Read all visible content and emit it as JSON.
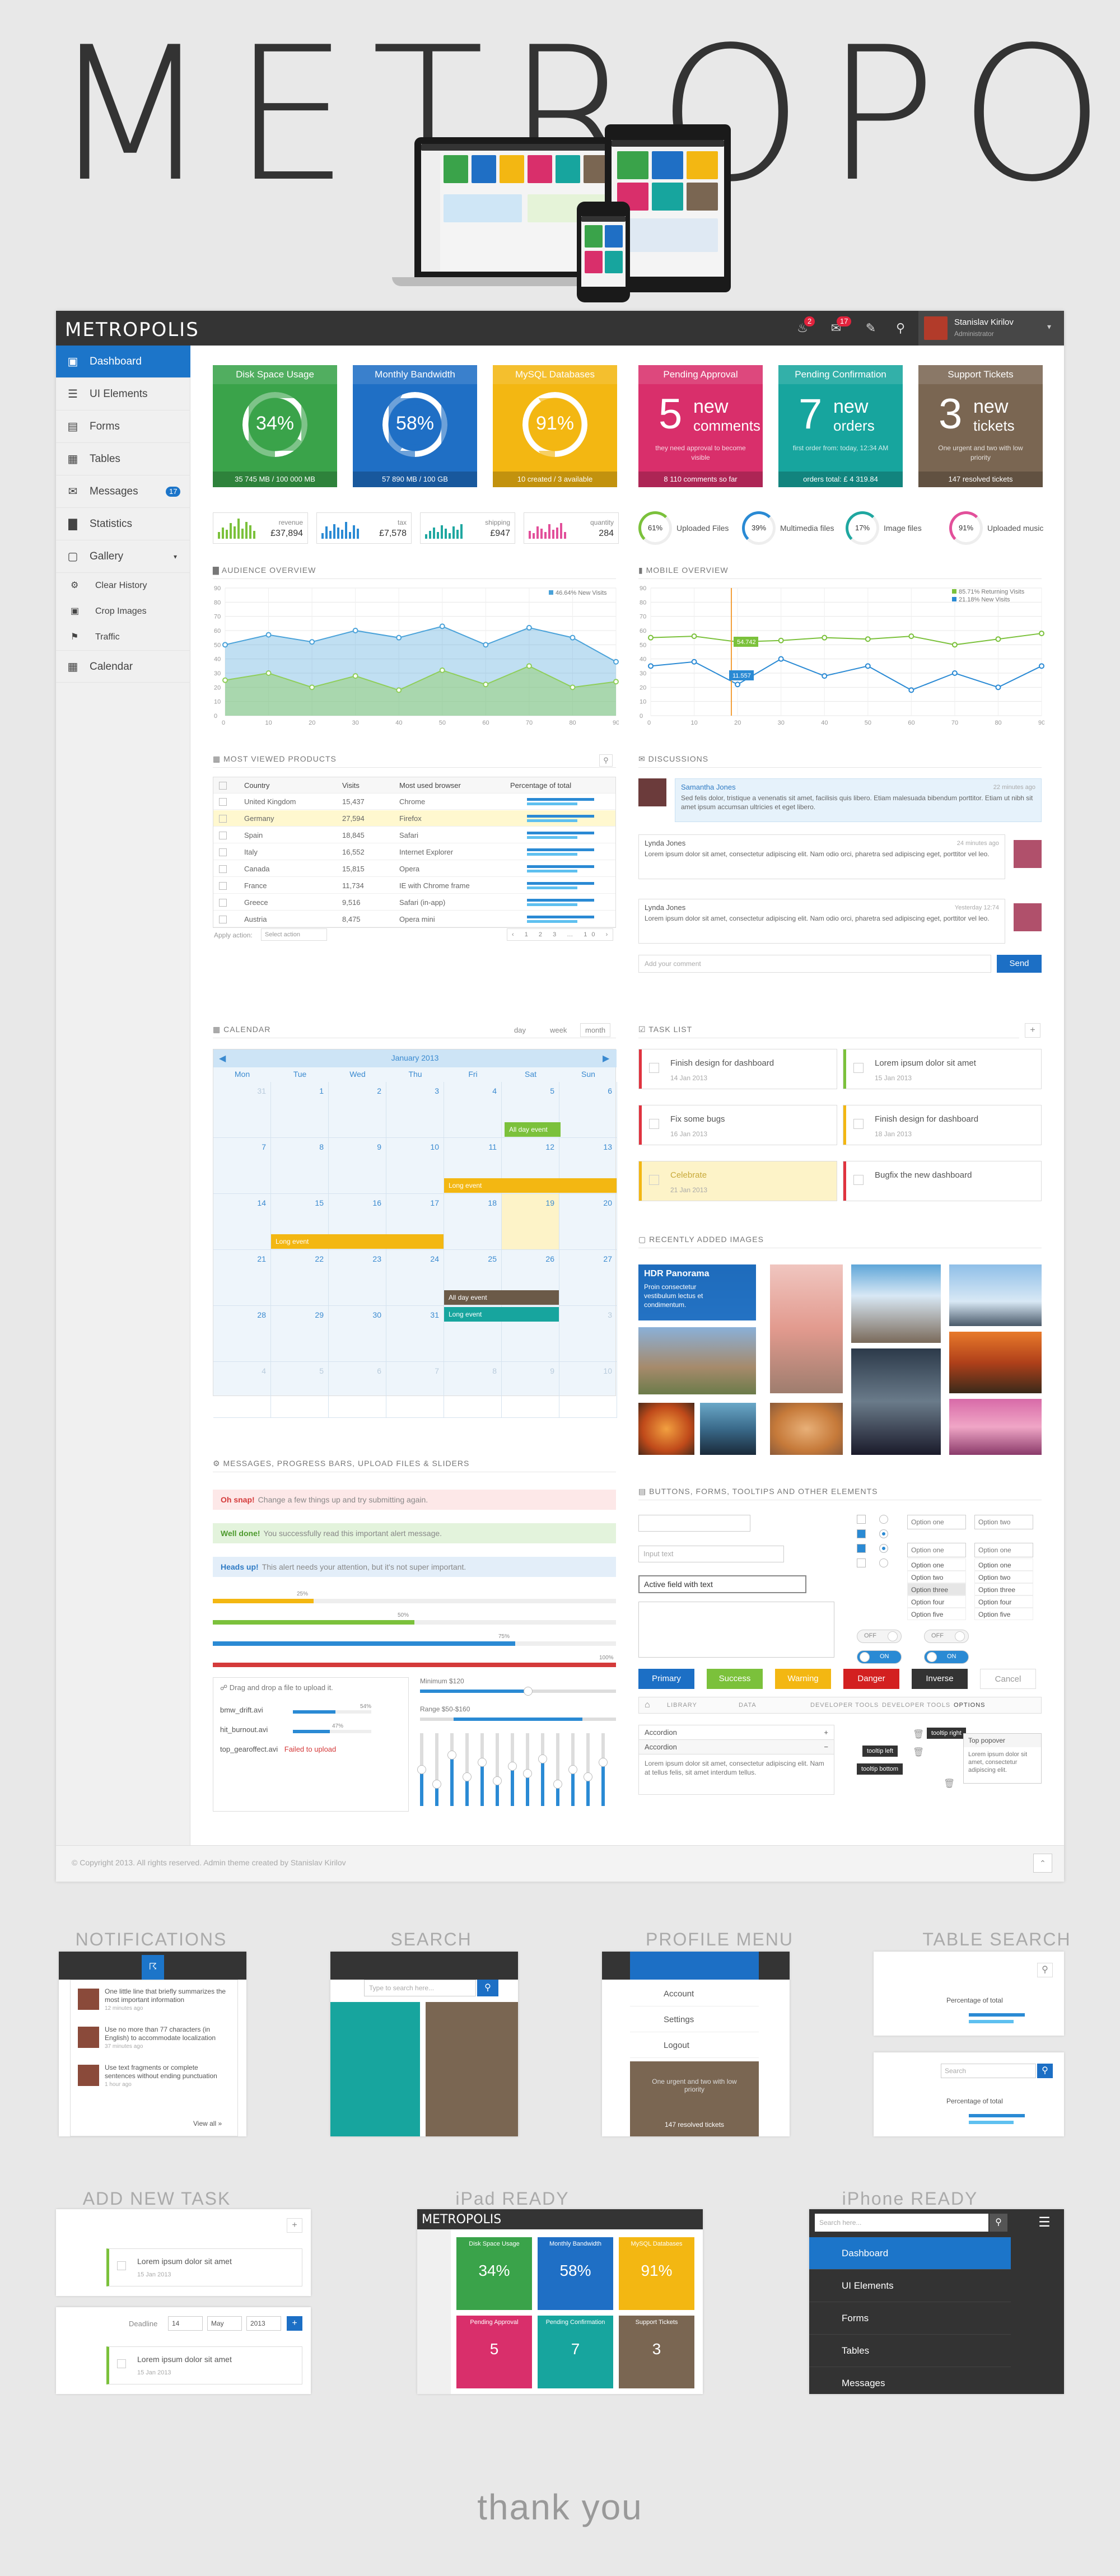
{
  "hero": {
    "title": "METROPOLIS"
  },
  "app": {
    "logo": "METROPOLIS",
    "notif_badge": "2",
    "mail_badge": "17",
    "user_name": "Stanislav Kirilov",
    "user_role": "Administrator"
  },
  "sidebar": {
    "items": [
      {
        "label": "Dashboard",
        "icon": "monitor-icon"
      },
      {
        "label": "UI Elements",
        "icon": "sliders-icon"
      },
      {
        "label": "Forms",
        "icon": "form-icon"
      },
      {
        "label": "Tables",
        "icon": "table-icon"
      },
      {
        "label": "Messages",
        "icon": "chat-icon",
        "badge": "17"
      },
      {
        "label": "Statistics",
        "icon": "chart-icon"
      },
      {
        "label": "Gallery",
        "icon": "image-icon"
      }
    ],
    "sub_items": [
      {
        "label": "Clear History"
      },
      {
        "label": "Crop Images"
      },
      {
        "label": "Traffic"
      }
    ],
    "calendar": {
      "label": "Calendar"
    }
  },
  "tiles": [
    {
      "title": "Disk Space Usage",
      "value": "34%",
      "footer": "35 745 MB / 100 000 MB",
      "color": "#3aa34a",
      "fill": 0.34
    },
    {
      "title": "Monthly Bandwidth",
      "value": "58%",
      "footer": "57 890 MB / 100 GB",
      "color": "#1f6fc5",
      "fill": 0.58
    },
    {
      "title": "MySQL Databases",
      "value": "91%",
      "footer": "10 created / 3 available",
      "color": "#f3b712",
      "fill": 0.91
    },
    {
      "title": "Pending Approval",
      "num": "5",
      "w1": "new",
      "w2": "comments",
      "desc": "they need approval to become visible",
      "footer": "8 110 comments so far",
      "color": "#d92f6b"
    },
    {
      "title": "Pending Confirmation",
      "num": "7",
      "w1": "new",
      "w2": "orders",
      "desc": "first order from: today, 12:34 AM",
      "footer": "orders total: £ 4 319.84",
      "color": "#17a59e"
    },
    {
      "title": "Support Tickets",
      "num": "3",
      "w1": "new",
      "w2": "tickets",
      "desc": "One urgent and two with low priority",
      "footer": "147 resolved tickets",
      "color": "#7a6652"
    }
  ],
  "stat_boxes": [
    {
      "label": "revenue",
      "value": "£37,894",
      "color": "#7bc13b"
    },
    {
      "label": "tax",
      "value": "£7,578",
      "color": "#2a8ad4"
    },
    {
      "label": "shipping",
      "value": "£947",
      "color": "#1fa7a0"
    },
    {
      "label": "quantity",
      "value": "284",
      "color": "#e24f9a"
    }
  ],
  "donuts": [
    {
      "value": "61%",
      "label": "Uploaded Files",
      "color": "#7bc13b"
    },
    {
      "value": "39%",
      "label": "Multimedia files",
      "color": "#2a8ad4"
    },
    {
      "value": "17%",
      "label": "Image files",
      "color": "#1fa7a0"
    },
    {
      "value": "91%",
      "label": "Uploaded music",
      "color": "#e24f9a"
    }
  ],
  "sections": {
    "audience": "AUDIENCE OVERVIEW",
    "mobile": "MOBILE OVERVIEW",
    "products": "MOST VIEWED PRODUCTS",
    "discussions": "DISCUSSIONS",
    "calendar": "CALENDAR",
    "tasks": "TASK LIST",
    "images": "RECENTLY ADDED IMAGES",
    "messages": "MESSAGES, PROGRESS BARS, UPLOAD FILES & SLIDERS",
    "buttons": "BUTTONS, FORMS, TOOLTIPS AND OTHER ELEMENTS"
  },
  "chart_data": [
    {
      "type": "area",
      "title": "",
      "legend": "46.64% New Visits",
      "x": [
        0,
        10,
        20,
        30,
        40,
        50,
        60,
        70,
        80,
        90
      ],
      "ylim": [
        0,
        90
      ],
      "y_ticks": [
        90,
        80,
        70,
        60,
        50,
        40,
        30,
        20,
        10,
        0
      ],
      "series": [
        {
          "values": [
            50,
            57,
            52,
            60,
            55,
            63,
            50,
            62,
            55,
            38
          ],
          "color": "#4aa2d9"
        },
        {
          "values": [
            25,
            30,
            20,
            28,
            18,
            32,
            22,
            35,
            20,
            24
          ],
          "color": "#8fce5a"
        }
      ]
    },
    {
      "type": "line",
      "title": "",
      "legend": [
        "85.71% Returning Visits",
        "21.18% New Visits"
      ],
      "x": [
        0,
        10,
        20,
        30,
        40,
        50,
        60,
        70,
        80,
        90
      ],
      "ylim": [
        0,
        90
      ],
      "y_ticks": [
        90,
        80,
        70,
        60,
        50,
        40,
        30,
        20,
        10,
        0
      ],
      "callouts": [
        "54.742",
        "11.557"
      ],
      "series": [
        {
          "name": "85.71% Returning Visits",
          "values": [
            55,
            56,
            52,
            53,
            55,
            54,
            56,
            50,
            54,
            58
          ],
          "color": "#7bc13b"
        },
        {
          "name": "21.18% New Visits",
          "values": [
            35,
            38,
            22,
            40,
            28,
            35,
            18,
            30,
            20,
            35
          ],
          "color": "#2a8ad4"
        }
      ]
    }
  ],
  "products": {
    "headers": [
      "Country",
      "Visits",
      "Most used browser",
      "Percentage of total"
    ],
    "rows": [
      {
        "country": "United Kingdom",
        "visits": "15,437",
        "browser": "Chrome"
      },
      {
        "country": "Germany",
        "visits": "27,594",
        "browser": "Firefox"
      },
      {
        "country": "Spain",
        "visits": "18,845",
        "browser": "Safari"
      },
      {
        "country": "Italy",
        "visits": "16,552",
        "browser": "Internet Explorer"
      },
      {
        "country": "Canada",
        "visits": "15,815",
        "browser": "Opera"
      },
      {
        "country": "France",
        "visits": "11,734",
        "browser": "IE with Chrome frame"
      },
      {
        "country": "Greece",
        "visits": "9,516",
        "browser": "Safari (in-app)"
      },
      {
        "country": "Austria",
        "visits": "8,475",
        "browser": "Opera mini"
      }
    ],
    "apply_label": "Apply action:",
    "select_label": "Select action"
  },
  "discussions": {
    "items": [
      {
        "author": "Samantha Jones",
        "time": "22 minutes ago",
        "text": "Sed felis dolor, tristique a venenatis sit amet, facilisis quis libero. Etiam malesuada bibendum porttitor. Etiam ut nibh sit amet ipsum accumsan ultricies et eget libero."
      },
      {
        "author": "Lynda Jones",
        "time": "24 minutes ago",
        "text": "Lorem ipsum dolor sit amet, consectetur adipiscing elit. Nam odio orci, pharetra sed adipiscing eget, porttitor vel leo."
      },
      {
        "author": "Lynda Jones",
        "time": "Yesterday 12:74",
        "text": "Lorem ipsum dolor sit amet, consectetur adipiscing elit. Nam odio orci, pharetra sed adipiscing eget, porttitor vel leo."
      }
    ],
    "placeholder": "Add your comment",
    "send": "Send"
  },
  "calendar": {
    "views": [
      "day",
      "week",
      "month"
    ],
    "month": "January 2013",
    "weekdays": [
      "Mon",
      "Tue",
      "Wed",
      "Thu",
      "Fri",
      "Sat",
      "Sun"
    ],
    "events": [
      {
        "label": "All day event"
      },
      {
        "label": "Long event"
      },
      {
        "label": "Long event"
      },
      {
        "label": "All day event"
      },
      {
        "label": "Long event"
      }
    ]
  },
  "tasks": [
    {
      "title": "Finish design for dashboard",
      "date": "14 Jan 2013",
      "color": "#e0333f"
    },
    {
      "title": "Lorem ipsum dolor sit amet",
      "date": "15 Jan 2013",
      "color": "#7bc13b"
    },
    {
      "title": "Fix some bugs",
      "date": "16 Jan 2013",
      "color": "#e0333f"
    },
    {
      "title": "Finish design for dashboard",
      "date": "18 Jan 2013",
      "color": "#f3b712"
    },
    {
      "title": "Celebrate",
      "date": "21 Jan 2013",
      "color": "#f3b712"
    },
    {
      "title": "Bugfix the new dashboard",
      "date": "",
      "color": "#e0333f"
    }
  ],
  "images": {
    "feature_title": "HDR Panorama",
    "feature_text": "Proin consectetur vestibulum lectus et condimentum."
  },
  "alerts": [
    {
      "strong": "Oh snap!",
      "text": "Change a few things up and try submitting again.",
      "color": "#fde8e8",
      "fg": "#d43a3a"
    },
    {
      "strong": "Well done!",
      "text": "You successfully read this important alert message.",
      "color": "#e3f3dc",
      "fg": "#4d9a2d"
    },
    {
      "strong": "Heads up!",
      "text": "This alert needs your attention, but it's not super important.",
      "color": "#e3eef9",
      "fg": "#2f7bc4"
    }
  ],
  "progress": [
    {
      "label": "25%",
      "value": 0.25,
      "color": "#f3b712"
    },
    {
      "label": "50%",
      "value": 0.5,
      "color": "#7bc13b"
    },
    {
      "label": "75%",
      "value": 0.75,
      "color": "#2a8ad4"
    },
    {
      "label": "100%",
      "value": 1.0,
      "color": "#d43a3a"
    }
  ],
  "upload": {
    "hint": "Drag and drop a file to upload it.",
    "files": [
      {
        "name": "bmw_drift.avi",
        "pct": "54%"
      },
      {
        "name": "hit_burnout.avi",
        "pct": "47%"
      },
      {
        "name": "top_gearoffect.avi",
        "status": "Failed to upload"
      }
    ],
    "min_label": "Minimum $120",
    "range_label": "Range $50-$160"
  },
  "form": {
    "input_text": "Input text",
    "active_field": "Active field with text",
    "options": [
      "Option one",
      "Option two",
      "Option three",
      "Option four",
      "Option five"
    ],
    "off": "OFF",
    "on": "ON"
  },
  "buttons": [
    {
      "label": "Primary",
      "color": "#1c6fc5"
    },
    {
      "label": "Success",
      "color": "#7bc13b"
    },
    {
      "label": "Warning",
      "color": "#f3b712"
    },
    {
      "label": "Danger",
      "color": "#d32020"
    },
    {
      "label": "Inverse",
      "color": "#333333"
    },
    {
      "label": "Cancel",
      "color": "#ffffff"
    }
  ],
  "breadcrumb": [
    "LIBRARY",
    "DATA",
    "DEVELOPER TOOLS",
    "DEVELOPER TOOLS",
    "OPTIONS"
  ],
  "accordion": {
    "items": [
      "Accordion",
      "Accordion"
    ],
    "text": "Lorem ipsum dolor sit amet, consectetur adipiscing elit. Nam at tellus felis, sit amet interdum tellus."
  },
  "tooltips": [
    "tooltip right",
    "tooltip left",
    "tooltip bottom"
  ],
  "popover": {
    "title": "Top popover",
    "text": "Lorem ipsum dolor sit amet, consectetur adipiscing elit."
  },
  "footer": "© Copyright 2013. All rights reserved. Admin theme created by Stanislav Kirilov",
  "showcase": {
    "titles": [
      "NOTIFICATIONS",
      "SEARCH",
      "PROFILE MENU",
      "TABLE SEARCH",
      "ADD NEW TASK",
      "iPad READY",
      "iPhone READY"
    ],
    "notifications": [
      {
        "text": "One little line that briefly summarizes the most important information",
        "time": "12 minutes ago"
      },
      {
        "text": "Use no more than 77 characters (in English) to accommodate localization",
        "time": "37 minutes ago"
      },
      {
        "text": "Use text fragments or complete sentences without ending punctuation",
        "time": "1 hour ago"
      }
    ],
    "view_all": "View all »",
    "search_placeholder": "Type to search here...",
    "profile_menu": [
      "Account",
      "Settings",
      "Logout"
    ],
    "profile_tile_desc": "One urgent and two with low priority",
    "profile_tile_footer": "147 resolved tickets",
    "table_search_placeholder": "Search",
    "table_header": "Percentage of total",
    "new_task": "Lorem ipsum dolor sit amet",
    "new_task_date": "15 Jan 2013",
    "deadline_label": "Deadline",
    "deadline_day": "14",
    "deadline_month": "May",
    "deadline_year": "2013",
    "iphone_search": "Search here...",
    "iphone_menu": [
      "Dashboard",
      "UI Elements",
      "Forms",
      "Tables",
      "Messages"
    ]
  },
  "thank_you": "thank you"
}
